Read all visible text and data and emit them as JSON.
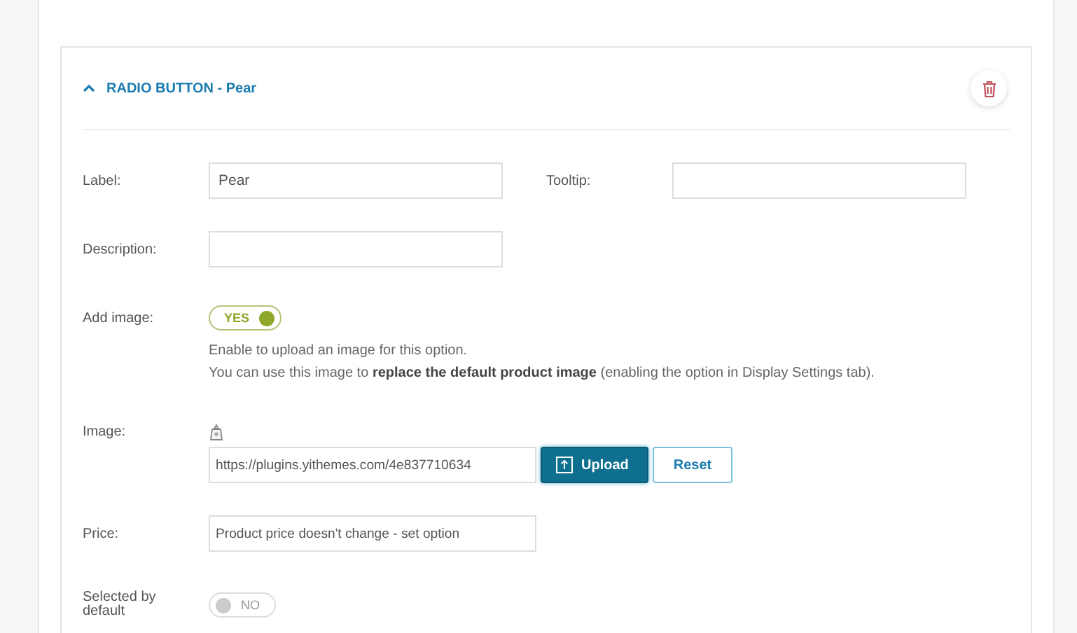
{
  "option": {
    "title": "RADIO BUTTON - Pear",
    "expanded": true
  },
  "label_field": {
    "label": "Label:",
    "value": "Pear"
  },
  "tooltip_field": {
    "label": "Tooltip:"
  },
  "description_field": {
    "label": "Description:"
  },
  "add_image": {
    "label": "Add image:",
    "on": true,
    "toggle_text": "YES",
    "help": [
      "Enable to upload an image for this option.",
      "You can use this image to **replace the default product image** (enabling the option in Display Settings tab)."
    ]
  },
  "image": {
    "label": "Image:",
    "value": "https://plugins.yithemes.com/4e837710634",
    "upload_button": "Upload",
    "reset_button": "Reset"
  },
  "price": {
    "label": "Price:",
    "value": "Product price doesn't change - set option"
  },
  "selected_default": {
    "label": "Selected by default",
    "on": false,
    "toggle_text": "NO"
  }
}
